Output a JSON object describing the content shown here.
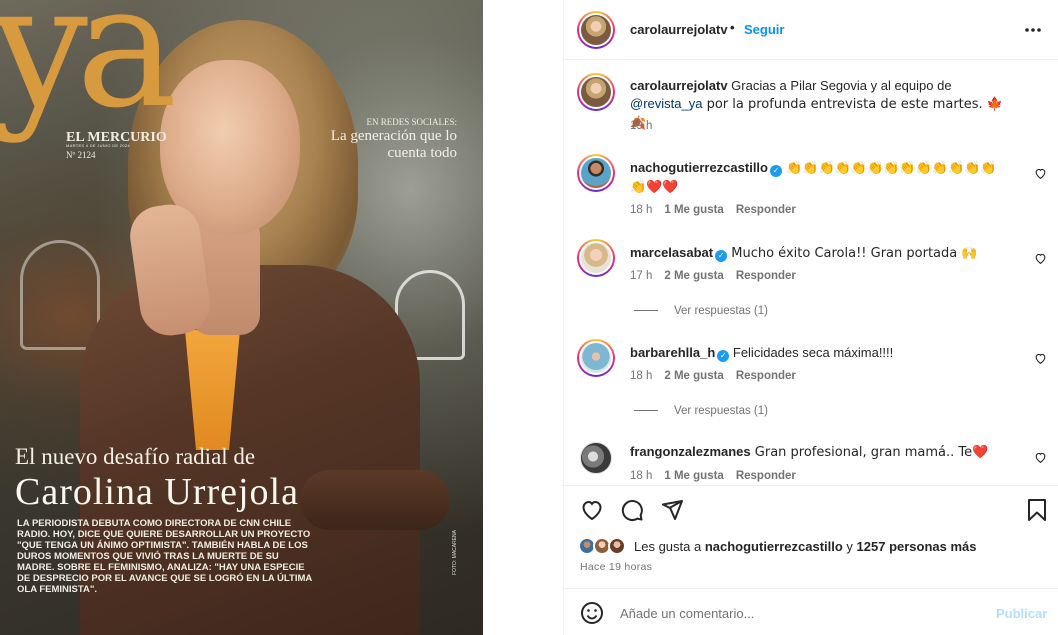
{
  "cover": {
    "logo": "ya",
    "masthead": "EL MERCURIO",
    "date": "MARTES 4 DE JUNIO DE 2024",
    "issue": "Nº 2124",
    "redes_kicker": "EN REDES SOCIALES:",
    "redes_headline": "La generación que lo cuenta todo",
    "kicker": "El nuevo desafío radial de",
    "title": "Carolina Urrejola",
    "body": "La periodista debuta como directora de CNN Chile Radio. Hoy, dice que quiere desarrollar un proyecto \"que tenga un ánimo optimista\". También habla de los duros momentos que vivió tras la muerte de su madre. Sobre el feminismo, analiza: \"Hay una especie de desprecio por el avance que se logró en la última ola feminista\".",
    "credit": "FOTO: MACARENA"
  },
  "header": {
    "username": "carolaurrejolatv",
    "separator": "•",
    "follow_label": "Seguir",
    "more_label": "•••"
  },
  "caption": {
    "username": "carolaurrejolatv",
    "text_before": " Gracias a Pilar Segovia y al equipo de ",
    "mention": "@revista_ya",
    "text_after": " por la profunda entrevista de este martes. 🍁🍂",
    "time": "19 h"
  },
  "comments": [
    {
      "username": "nachogutierrezcastillo",
      "verified": true,
      "text": " 👏👏👏👏👏👏👏👏👏👏👏👏👏👏❤️❤️",
      "time": "18 h",
      "likes": "1 Me gusta",
      "reply": "Responder"
    },
    {
      "username": "marcelasabat",
      "verified": true,
      "text": " Mucho éxito Carola!! Gran portada 🙌",
      "time": "17 h",
      "likes": "2 Me gusta",
      "reply": "Responder",
      "view_replies": "Ver respuestas (1)"
    },
    {
      "username": "barbarehlla_h",
      "verified": true,
      "text": " Felicidades seca máxima!!!!",
      "time": "18 h",
      "likes": "2 Me gusta",
      "reply": "Responder",
      "view_replies": "Ver respuestas (1)"
    },
    {
      "username": "frangonzalezmanes",
      "verified": false,
      "text": " Gran profesional, gran mamá.. Te❤️",
      "time": "18 h",
      "likes": "1 Me gusta",
      "reply": "Responder"
    }
  ],
  "likes": {
    "prefix": "Les gusta a ",
    "user": "nachogutierrezcastillo",
    "middle": " y ",
    "others": "1257 personas más"
  },
  "timestamp": "Hace 19 horas",
  "add_comment": {
    "placeholder": "Añade un comentario...",
    "publish_label": "Publicar"
  },
  "icons": [
    "heart-icon",
    "comment-icon",
    "share-icon",
    "bookmark-icon",
    "emoji-icon",
    "more-icon",
    "verified-icon"
  ],
  "colors": {
    "link": "#0095f6",
    "mention": "#00376b",
    "muted": "#737373",
    "publish_disabled": "#b2dffc",
    "verified": "#1d9bf0"
  }
}
